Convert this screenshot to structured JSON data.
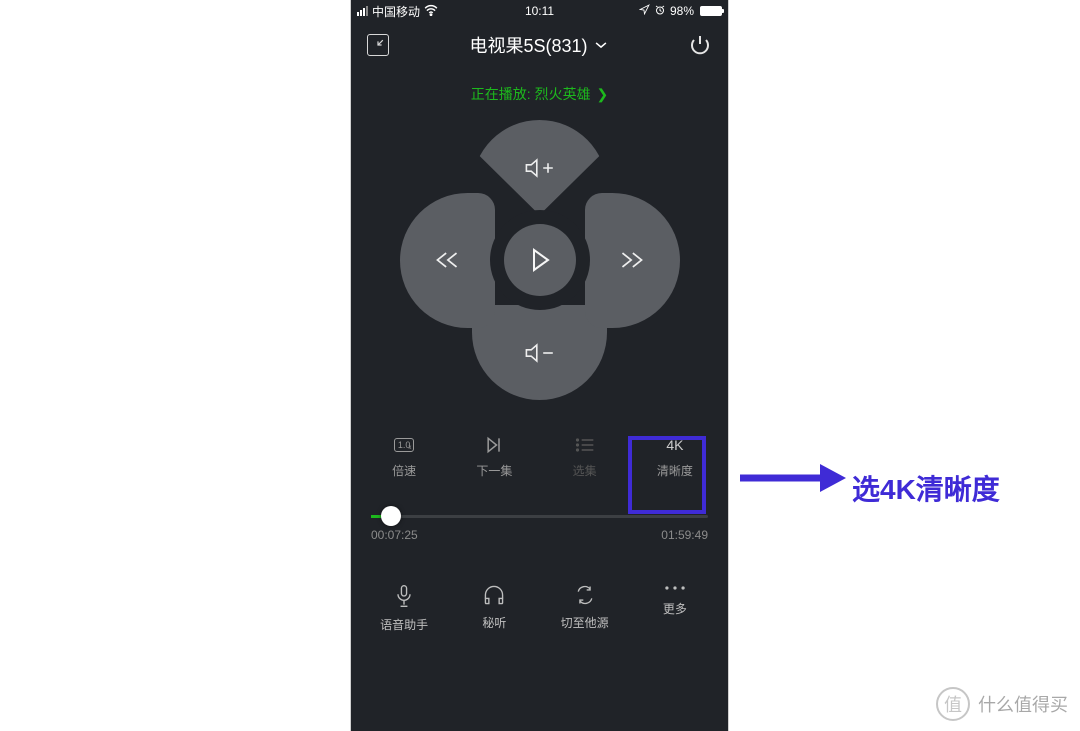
{
  "status": {
    "carrier": "中国移动",
    "time": "10:11",
    "battery_pct": "98%"
  },
  "header": {
    "device_name": "电视果5S(831)"
  },
  "now_playing": {
    "prefix": "正在播放:",
    "title": "烈火英雄"
  },
  "controls": {
    "speed_value": "1.0",
    "speed_label": "倍速",
    "next_label": "下一集",
    "episodes_label": "选集",
    "quality_value": "4K",
    "quality_label": "清晰度"
  },
  "progress": {
    "current": "00:07:25",
    "total": "01:59:49",
    "percent": 6
  },
  "bottom": {
    "voice_label": "语音助手",
    "listen_label": "秘听",
    "source_label": "切至他源",
    "more_label": "更多"
  },
  "annotation": {
    "text": "选4K清晰度"
  },
  "watermark": {
    "badge": "值",
    "text": "什么值得买"
  },
  "colors": {
    "accent_green": "#1db91d",
    "highlight_blue": "#3f2bd6",
    "bg_dark": "#202328",
    "dpad_grey": "#5b5e63"
  }
}
